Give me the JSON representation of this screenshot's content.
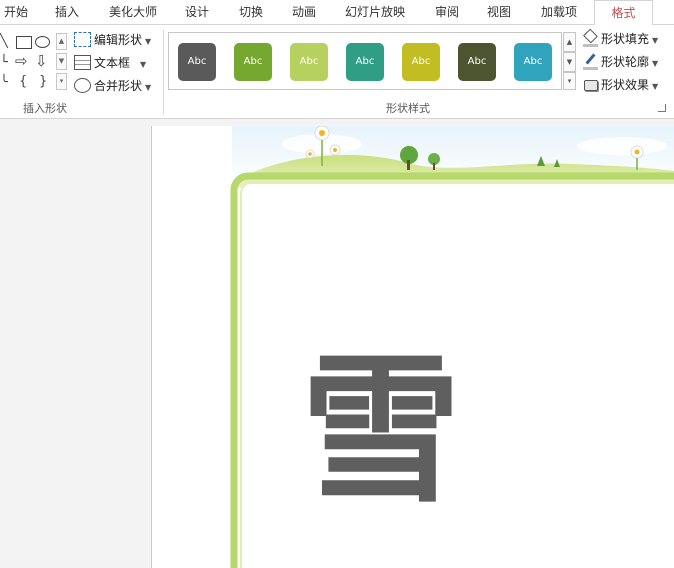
{
  "tabs": [
    {
      "label": "开始",
      "active": false
    },
    {
      "label": "插入",
      "active": false
    },
    {
      "label": "美化大师",
      "active": false
    },
    {
      "label": "设计",
      "active": false
    },
    {
      "label": "切换",
      "active": false
    },
    {
      "label": "动画",
      "active": false
    },
    {
      "label": "幻灯片放映",
      "active": false
    },
    {
      "label": "审阅",
      "active": false
    },
    {
      "label": "视图",
      "active": false
    },
    {
      "label": "加载项",
      "active": false
    },
    {
      "label": "格式",
      "active": true
    }
  ],
  "insert_shapes": {
    "edit_shape_label": "编辑形状",
    "text_box_label": "文本框",
    "merge_shapes_label": "合并形状",
    "group_label": "插入形状"
  },
  "shape_styles": {
    "group_label": "形状样式",
    "swatches": [
      {
        "text": "Abc",
        "color": "#5a5a5a"
      },
      {
        "text": "Abc",
        "color": "#76a830"
      },
      {
        "text": "Abc",
        "color": "#b7d160"
      },
      {
        "text": "Abc",
        "color": "#2f9e84"
      },
      {
        "text": "Abc",
        "color": "#c3bd24"
      },
      {
        "text": "Abc",
        "color": "#4c5430"
      },
      {
        "text": "Abc",
        "color": "#30a4bc"
      }
    ],
    "fill_label": "形状填充",
    "outline_label": "形状轮廓",
    "effects_label": "形状效果"
  },
  "slide": {
    "big_glyph": "雪",
    "glyph_color": "#5f5f5f",
    "frame_color": "#9cc63c"
  }
}
